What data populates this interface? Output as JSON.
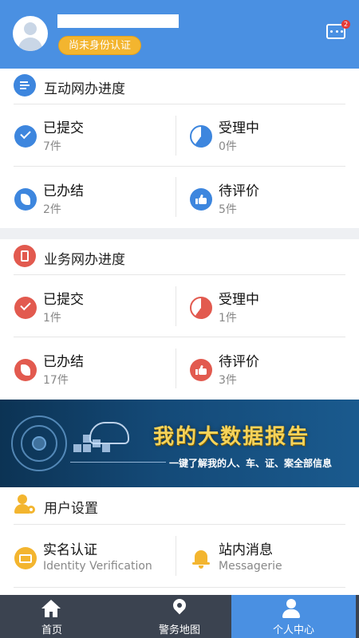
{
  "header": {
    "verify_badge": "尚未身份认证",
    "message_count": "2"
  },
  "interactive_progress": {
    "title": "互动网办进度",
    "items": [
      {
        "label": "已提交",
        "count": "7件"
      },
      {
        "label": "受理中",
        "count": "0件"
      },
      {
        "label": "已办结",
        "count": "2件"
      },
      {
        "label": "待评价",
        "count": "5件"
      }
    ]
  },
  "business_progress": {
    "title": "业务网办进度",
    "items": [
      {
        "label": "已提交",
        "count": "1件"
      },
      {
        "label": "受理中",
        "count": "1件"
      },
      {
        "label": "已办结",
        "count": "17件"
      },
      {
        "label": "待评价",
        "count": "3件"
      }
    ]
  },
  "banner": {
    "title": "我的大数据报告",
    "subtitle": "一键了解我的人、车、证、案全部信息"
  },
  "user_settings": {
    "title": "用户设置",
    "items": [
      {
        "label": "实名认证",
        "sub": "Identity Verification"
      },
      {
        "label": "站内消息",
        "sub": "Messagerie"
      }
    ]
  },
  "tabbar": {
    "tabs": [
      {
        "label": "首页",
        "icon": "home-icon"
      },
      {
        "label": "警务地图",
        "icon": "map-pin-icon"
      },
      {
        "label": "个人中心",
        "icon": "person-icon"
      }
    ],
    "active": 2
  },
  "colors": {
    "header": "#4a90e2",
    "blue_icon": "#3d86de",
    "red_icon": "#e25a4f",
    "orange": "#f3b52f",
    "tabbar": "#3b4350"
  }
}
